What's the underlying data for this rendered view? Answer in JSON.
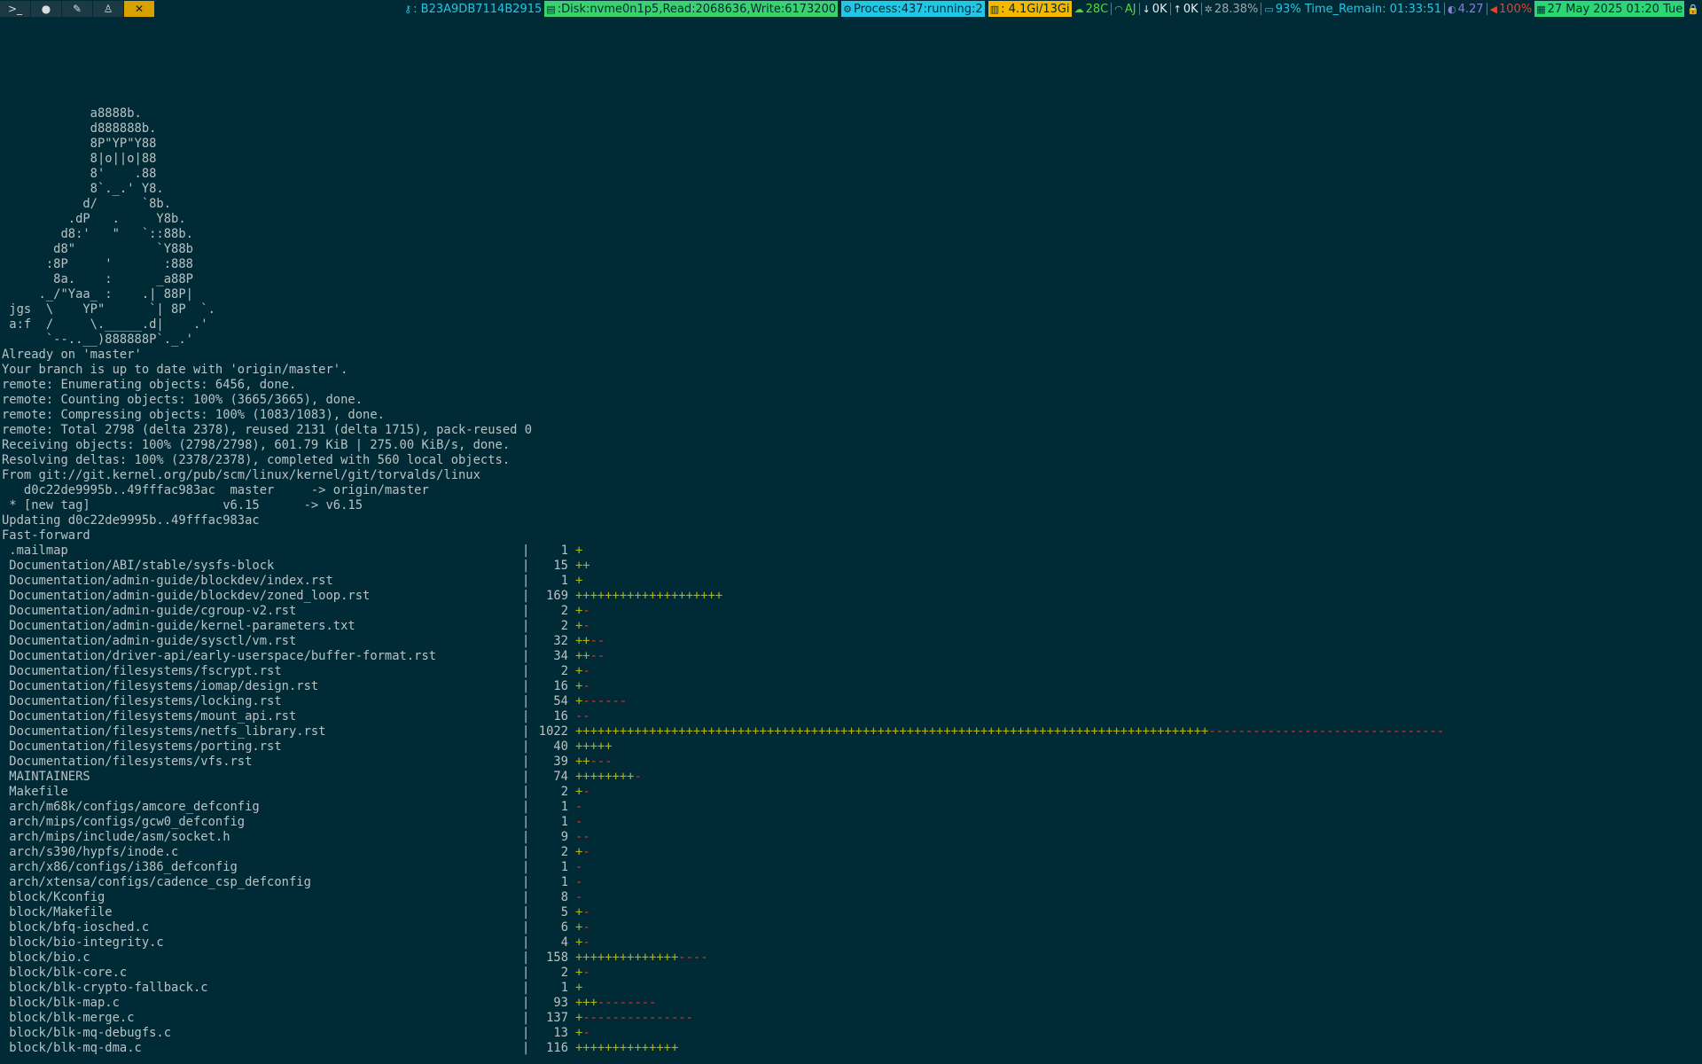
{
  "taskbar": {
    "tags": [
      {
        "label": ">_",
        "icon": "terminal-icon",
        "active": false
      },
      {
        "label": "●",
        "icon": "browser-icon",
        "active": false
      },
      {
        "label": "✎",
        "icon": "editor-icon",
        "active": false
      },
      {
        "label": "♙",
        "icon": "linux-icon",
        "active": false
      },
      {
        "label": "✕",
        "icon": "tools-icon",
        "active": true
      }
    ],
    "status": [
      {
        "name": "serial",
        "icon": "key-icon",
        "icon_glyph": "⚷",
        "text": ": B23A9DB7114B2915",
        "fg": "#22c7e5",
        "bg": ""
      },
      {
        "name": "disk",
        "icon": "disk-icon",
        "icon_glyph": "▤",
        "text": ":Disk:nvme0n1p5,Read:2068636,Write:6173200",
        "fg": "#002b36",
        "bg": "#3bd16f"
      },
      {
        "name": "process",
        "icon": "process-icon",
        "icon_glyph": "⚙",
        "text": " Process:437:running:2",
        "fg": "#002b36",
        "bg": "#22c7e5"
      },
      {
        "name": "memory",
        "icon": "chart-icon",
        "icon_glyph": "▥",
        "text": " : 4.1Gi/13Gi",
        "fg": "#002b36",
        "bg": "#f5b800"
      },
      {
        "name": "temp",
        "icon": "cloud-icon",
        "icon_glyph": "☁",
        "text": "28C",
        "fg": "#4fd83c",
        "bg": ""
      },
      {
        "name": "wifi",
        "icon": "wifi-icon",
        "icon_glyph": "◠",
        "text": "AJ",
        "fg": "#4fd83c",
        "bg": ""
      },
      {
        "name": "net",
        "icon": "arrow-down-icon",
        "icon_glyph": "↓",
        "text": "0K",
        "fg": "#e6f1f3",
        "bg": ""
      },
      {
        "name": "net-up",
        "icon": "arrow-up-icon",
        "icon_glyph": "↑",
        "text": "0K",
        "fg": "#e6f1f3",
        "bg": ""
      },
      {
        "name": "cpu",
        "icon": "gear-icon",
        "icon_glyph": "✲",
        "text": "28.38%",
        "fg": "#9aa8ac",
        "bg": ""
      },
      {
        "name": "battery",
        "icon": "battery-icon",
        "icon_glyph": "▭",
        "text": "93% Time_Remain: 01:33:51",
        "fg": "#22c7e5",
        "bg": ""
      },
      {
        "name": "brightness",
        "icon": "brightness-icon",
        "icon_glyph": "◐",
        "text": "4.27",
        "fg": "#8c7fd6",
        "bg": ""
      },
      {
        "name": "volume",
        "icon": "speaker-icon",
        "icon_glyph": "◀",
        "text": "100%",
        "fg": "#e0452f",
        "bg": ""
      },
      {
        "name": "date",
        "icon": "calendar-icon",
        "icon_glyph": "▦",
        "text": "27 May 2025 01:20 Tue",
        "fg": "#002b36",
        "bg": "#2bd673"
      },
      {
        "name": "lock",
        "icon": "lock-icon",
        "icon_glyph": "🔒",
        "text": "",
        "fg": "#4fd83c",
        "bg": ""
      }
    ]
  },
  "terminal": {
    "ascii_art": [
      "            a8888b.",
      "            d888888b.",
      "            8P\"YP\"Y88",
      "            8|o||o|88",
      "            8'    .88",
      "            8`._.' Y8.",
      "           d/      `8b.",
      "         .dP   .     Y8b.",
      "        d8:'   \"   `::88b.",
      "       d8\"           `Y88b",
      "      :8P     '       :888",
      "       8a.    :      _a88P",
      "     ._/\"Yaa_ :    .| 88P|",
      " jgs  \\    YP\"      `| 8P  `.",
      " a:f  /     \\._____.d|    .'",
      "      `--..__)888888P`._.'"
    ],
    "output": [
      "Already on 'master'",
      "Your branch is up to date with 'origin/master'.",
      "remote: Enumerating objects: 6456, done.",
      "remote: Counting objects: 100% (3665/3665), done.",
      "remote: Compressing objects: 100% (1083/1083), done.",
      "remote: Total 2798 (delta 2378), reused 2131 (delta 1715), pack-reused 0",
      "Receiving objects: 100% (2798/2798), 601.79 KiB | 275.00 KiB/s, done.",
      "Resolving deltas: 100% (2378/2378), completed with 560 local objects.",
      "From git://git.kernel.org/pub/scm/linux/kernel/git/torvalds/linux",
      "   d0c22de9995b..49fffac983ac  master     -> origin/master",
      " * [new tag]                  v6.15      -> v6.15",
      "Updating d0c22de9995b..49fffac983ac",
      "Fast-forward"
    ],
    "diffstat": [
      {
        "file": ".mailmap",
        "count": "1",
        "plus": "+",
        "minus": ""
      },
      {
        "file": "Documentation/ABI/stable/sysfs-block",
        "count": "15",
        "plus": "++",
        "minus": ""
      },
      {
        "file": "Documentation/admin-guide/blockdev/index.rst",
        "count": "1",
        "plus": "+",
        "minus": ""
      },
      {
        "file": "Documentation/admin-guide/blockdev/zoned_loop.rst",
        "count": "169",
        "plus": "++++++++++++++++++++",
        "minus": ""
      },
      {
        "file": "Documentation/admin-guide/cgroup-v2.rst",
        "count": "2",
        "plus": "+",
        "minus": "-"
      },
      {
        "file": "Documentation/admin-guide/kernel-parameters.txt",
        "count": "2",
        "plus": "+",
        "minus": "-"
      },
      {
        "file": "Documentation/admin-guide/sysctl/vm.rst",
        "count": "32",
        "plus": "++",
        "minus": "--"
      },
      {
        "file": "Documentation/driver-api/early-userspace/buffer-format.rst",
        "count": "34",
        "plus": "++",
        "minus": "--"
      },
      {
        "file": "Documentation/filesystems/fscrypt.rst",
        "count": "2",
        "plus": "+",
        "minus": "-"
      },
      {
        "file": "Documentation/filesystems/iomap/design.rst",
        "count": "16",
        "plus": "+",
        "minus": "-"
      },
      {
        "file": "Documentation/filesystems/locking.rst",
        "count": "54",
        "plus": "+",
        "minus": "------"
      },
      {
        "file": "Documentation/filesystems/mount_api.rst",
        "count": "16",
        "plus": "",
        "minus": "--"
      },
      {
        "file": "Documentation/filesystems/netfs_library.rst",
        "count": "1022",
        "plus": "++++++++++++++++++++++++++++++++++++++++++++++++++++++++++++++++++++++++++++++++++++++",
        "minus": "--------------------------------"
      },
      {
        "file": "Documentation/filesystems/porting.rst",
        "count": "40",
        "plus": "+++++",
        "minus": ""
      },
      {
        "file": "Documentation/filesystems/vfs.rst",
        "count": "39",
        "plus": "++",
        "minus": "---"
      },
      {
        "file": "MAINTAINERS",
        "count": "74",
        "plus": "++++++++",
        "minus": "-"
      },
      {
        "file": "Makefile",
        "count": "2",
        "plus": "+",
        "minus": "-"
      },
      {
        "file": "arch/m68k/configs/amcore_defconfig",
        "count": "1",
        "plus": "",
        "minus": "-"
      },
      {
        "file": "arch/mips/configs/gcw0_defconfig",
        "count": "1",
        "plus": "",
        "minus": "-"
      },
      {
        "file": "arch/mips/include/asm/socket.h",
        "count": "9",
        "plus": "",
        "minus": "--"
      },
      {
        "file": "arch/s390/hypfs/inode.c",
        "count": "2",
        "plus": "+",
        "minus": "-"
      },
      {
        "file": "arch/x86/configs/i386_defconfig",
        "count": "1",
        "plus": "",
        "minus": "-"
      },
      {
        "file": "arch/xtensa/configs/cadence_csp_defconfig",
        "count": "1",
        "plus": "",
        "minus": "-"
      },
      {
        "file": "block/Kconfig",
        "count": "8",
        "plus": "",
        "minus": "-"
      },
      {
        "file": "block/Makefile",
        "count": "5",
        "plus": "+",
        "minus": "-"
      },
      {
        "file": "block/bfq-iosched.c",
        "count": "6",
        "plus": "+",
        "minus": "-"
      },
      {
        "file": "block/bio-integrity.c",
        "count": "4",
        "plus": "+",
        "minus": "-"
      },
      {
        "file": "block/bio.c",
        "count": "158",
        "plus": "++++++++++++++",
        "minus": "----"
      },
      {
        "file": "block/blk-core.c",
        "count": "2",
        "plus": "+",
        "minus": "-"
      },
      {
        "file": "block/blk-crypto-fallback.c",
        "count": "1",
        "plus": "+",
        "minus": ""
      },
      {
        "file": "block/blk-map.c",
        "count": "93",
        "plus": "+++",
        "minus": "--------"
      },
      {
        "file": "block/blk-merge.c",
        "count": "137",
        "plus": "+",
        "minus": "---------------"
      },
      {
        "file": "block/blk-mq-debugfs.c",
        "count": "13",
        "plus": "+",
        "minus": "-"
      },
      {
        "file": "block/blk-mq-dma.c",
        "count": "116",
        "plus": "++++++++++++++",
        "minus": ""
      }
    ]
  }
}
